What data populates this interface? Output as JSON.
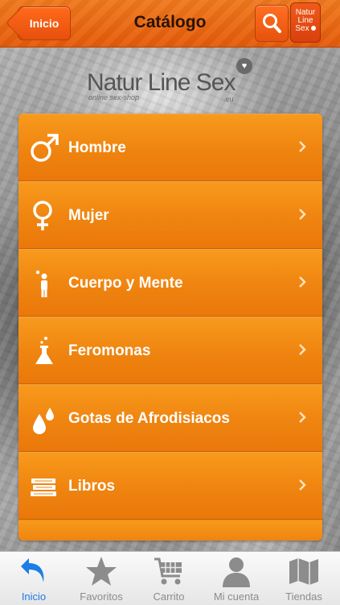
{
  "nav": {
    "back_label": "Inicio",
    "title": "Catálogo",
    "brand_lines": [
      "Natur",
      "Line",
      "Sex"
    ]
  },
  "logo": {
    "main": "Natur Line Sex",
    "sub": "online sex-shop",
    "tld": ".eu"
  },
  "menu": {
    "items": [
      {
        "label": "Hombre",
        "icon": "male-symbol-icon"
      },
      {
        "label": "Mujer",
        "icon": "female-symbol-icon"
      },
      {
        "label": "Cuerpo y Mente",
        "icon": "person-icon"
      },
      {
        "label": "Feromonas",
        "icon": "flask-icon"
      },
      {
        "label": "Gotas de Afrodisiacos",
        "icon": "drops-icon"
      },
      {
        "label": "Libros",
        "icon": "books-icon"
      }
    ]
  },
  "tabs": [
    {
      "label": "Inicio",
      "icon": "back-arrow-icon",
      "active": true
    },
    {
      "label": "Favoritos",
      "icon": "star-icon",
      "active": false
    },
    {
      "label": "Carrito",
      "icon": "cart-icon",
      "active": false
    },
    {
      "label": "Mi cuenta",
      "icon": "user-icon",
      "active": false
    },
    {
      "label": "Tiendas",
      "icon": "map-icon",
      "active": false
    }
  ],
  "colors": {
    "accent": "#ef8410",
    "topbar": "#e65b0a",
    "tab_active": "#1b7ee6",
    "tab_inactive": "#8c8c8c"
  }
}
